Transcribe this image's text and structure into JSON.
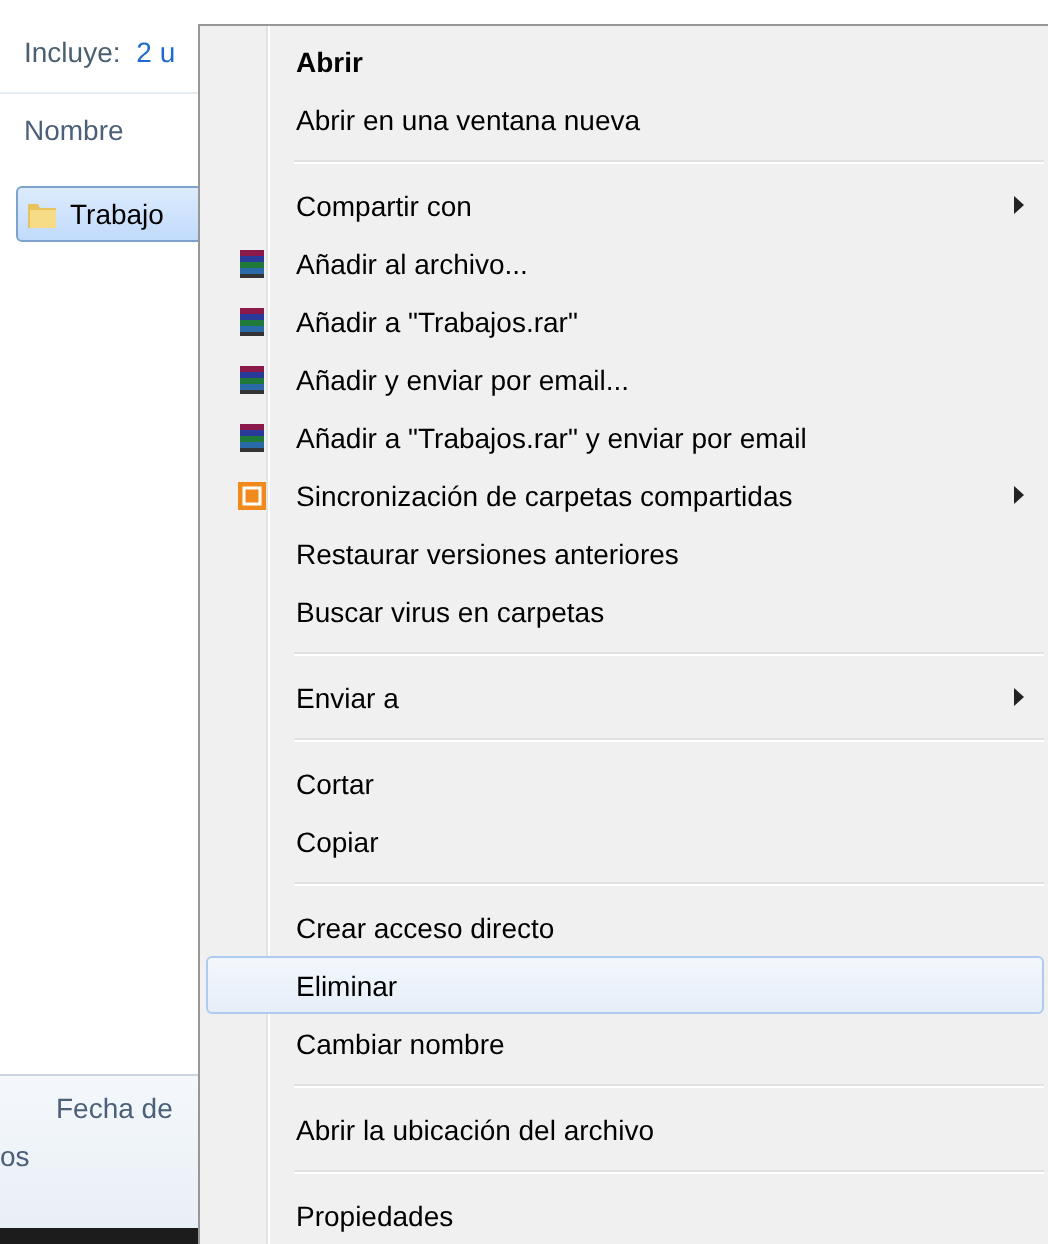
{
  "explorer": {
    "includes_label": "Incluye:",
    "includes_link": "2 u",
    "column_header": "Nombre",
    "file": {
      "name": "Trabajo",
      "selected": true
    },
    "details_label": "Fecha de",
    "details_value": "os"
  },
  "context_menu": {
    "items": [
      {
        "kind": "item",
        "label": "Abrir",
        "bold": true,
        "submenu": false,
        "selected": false
      },
      {
        "kind": "item",
        "label": "Abrir en una ventana nueva",
        "bold": false,
        "submenu": false,
        "selected": false
      },
      {
        "kind": "separator"
      },
      {
        "kind": "item",
        "label": "Compartir con",
        "bold": false,
        "submenu": true,
        "selected": false
      },
      {
        "kind": "archive",
        "label": "Añadir al archivo...",
        "bold": false,
        "submenu": false,
        "selected": false
      },
      {
        "kind": "archive",
        "label": "Añadir a \"Trabajos.rar\"",
        "bold": false,
        "submenu": false,
        "selected": false
      },
      {
        "kind": "archive",
        "label": "Añadir y enviar por email...",
        "bold": false,
        "submenu": false,
        "selected": false
      },
      {
        "kind": "archive",
        "label": "Añadir a \"Trabajos.rar\" y enviar por email",
        "bold": false,
        "submenu": false,
        "selected": false
      },
      {
        "kind": "sync",
        "label": "Sincronización de carpetas compartidas",
        "bold": false,
        "submenu": true,
        "selected": false
      },
      {
        "kind": "item",
        "label": "Restaurar versiones anteriores",
        "bold": false,
        "submenu": false,
        "selected": false
      },
      {
        "kind": "item",
        "label": "Buscar virus en carpetas",
        "bold": false,
        "submenu": false,
        "selected": false
      },
      {
        "kind": "separator"
      },
      {
        "kind": "item",
        "label": "Enviar a",
        "bold": false,
        "submenu": true,
        "selected": false
      },
      {
        "kind": "separator"
      },
      {
        "kind": "item",
        "label": "Cortar",
        "bold": false,
        "submenu": false,
        "selected": false
      },
      {
        "kind": "item",
        "label": "Copiar",
        "bold": false,
        "submenu": false,
        "selected": false
      },
      {
        "kind": "separator"
      },
      {
        "kind": "item",
        "label": "Crear acceso directo",
        "bold": false,
        "submenu": false,
        "selected": false
      },
      {
        "kind": "item",
        "label": "Eliminar",
        "bold": false,
        "submenu": false,
        "selected": true
      },
      {
        "kind": "item",
        "label": "Cambiar nombre",
        "bold": false,
        "submenu": false,
        "selected": false
      },
      {
        "kind": "separator"
      },
      {
        "kind": "item",
        "label": "Abrir la ubicación del archivo",
        "bold": false,
        "submenu": false,
        "selected": false
      },
      {
        "kind": "separator"
      },
      {
        "kind": "item",
        "label": "Propiedades",
        "bold": false,
        "submenu": false,
        "selected": false
      }
    ]
  }
}
